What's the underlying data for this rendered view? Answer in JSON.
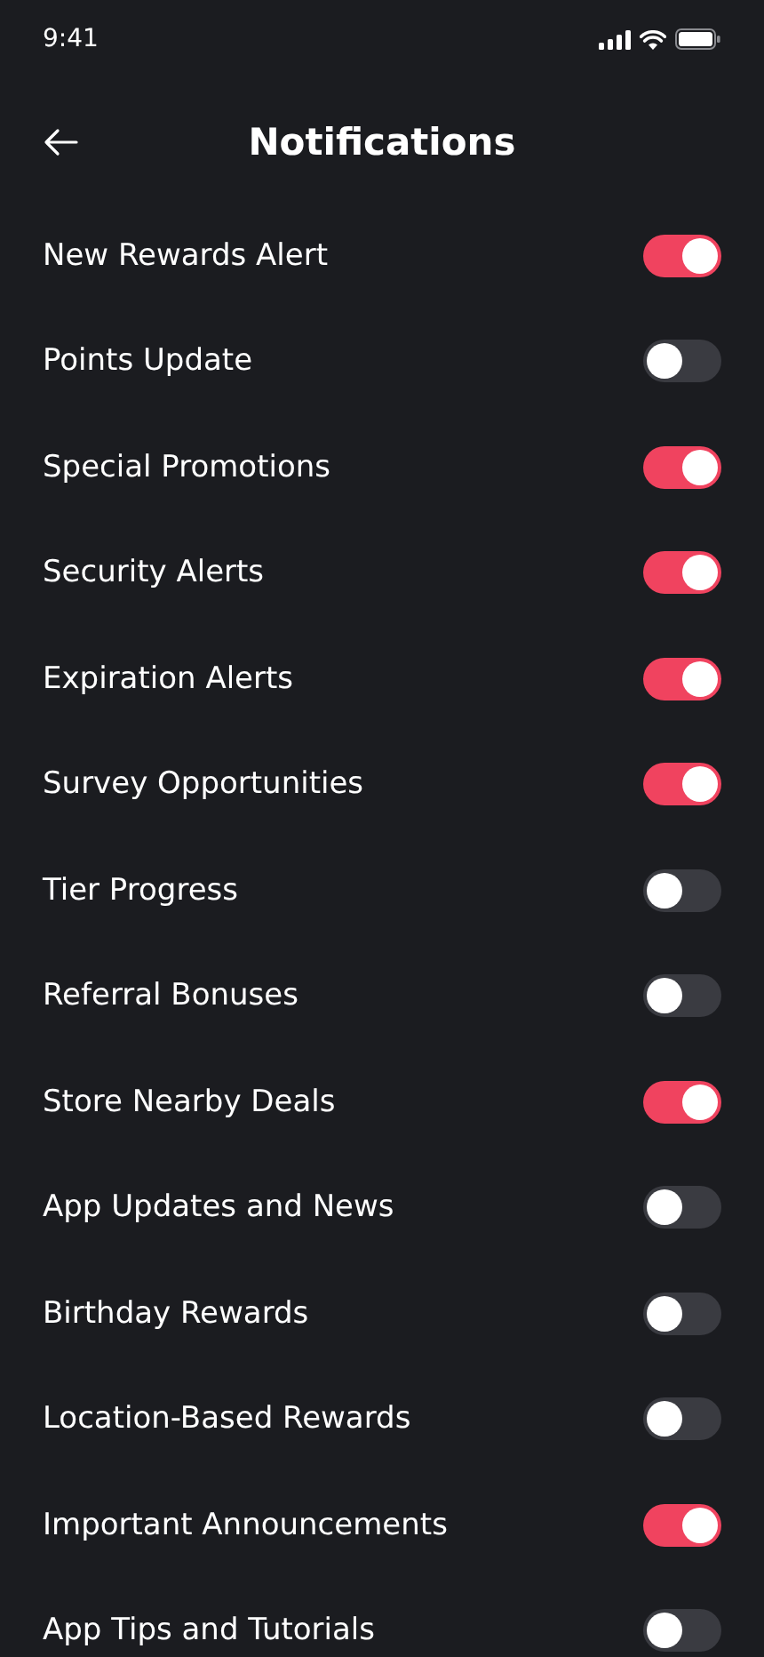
{
  "status_bar": {
    "time": "9:41"
  },
  "header": {
    "title": "Notifications"
  },
  "settings": [
    {
      "label": "New Rewards Alert",
      "on": true
    },
    {
      "label": "Points Update",
      "on": false
    },
    {
      "label": "Special Promotions",
      "on": true
    },
    {
      "label": "Security Alerts",
      "on": true
    },
    {
      "label": "Expiration Alerts",
      "on": true
    },
    {
      "label": "Survey Opportunities",
      "on": true
    },
    {
      "label": "Tier Progress",
      "on": false
    },
    {
      "label": "Referral Bonuses",
      "on": false
    },
    {
      "label": "Store Nearby Deals",
      "on": true
    },
    {
      "label": "App Updates and News",
      "on": false
    },
    {
      "label": "Birthday Rewards",
      "on": false
    },
    {
      "label": "Location-Based Rewards",
      "on": false
    },
    {
      "label": "Important Announcements",
      "on": true
    },
    {
      "label": "App Tips and Tutorials",
      "on": false
    }
  ]
}
